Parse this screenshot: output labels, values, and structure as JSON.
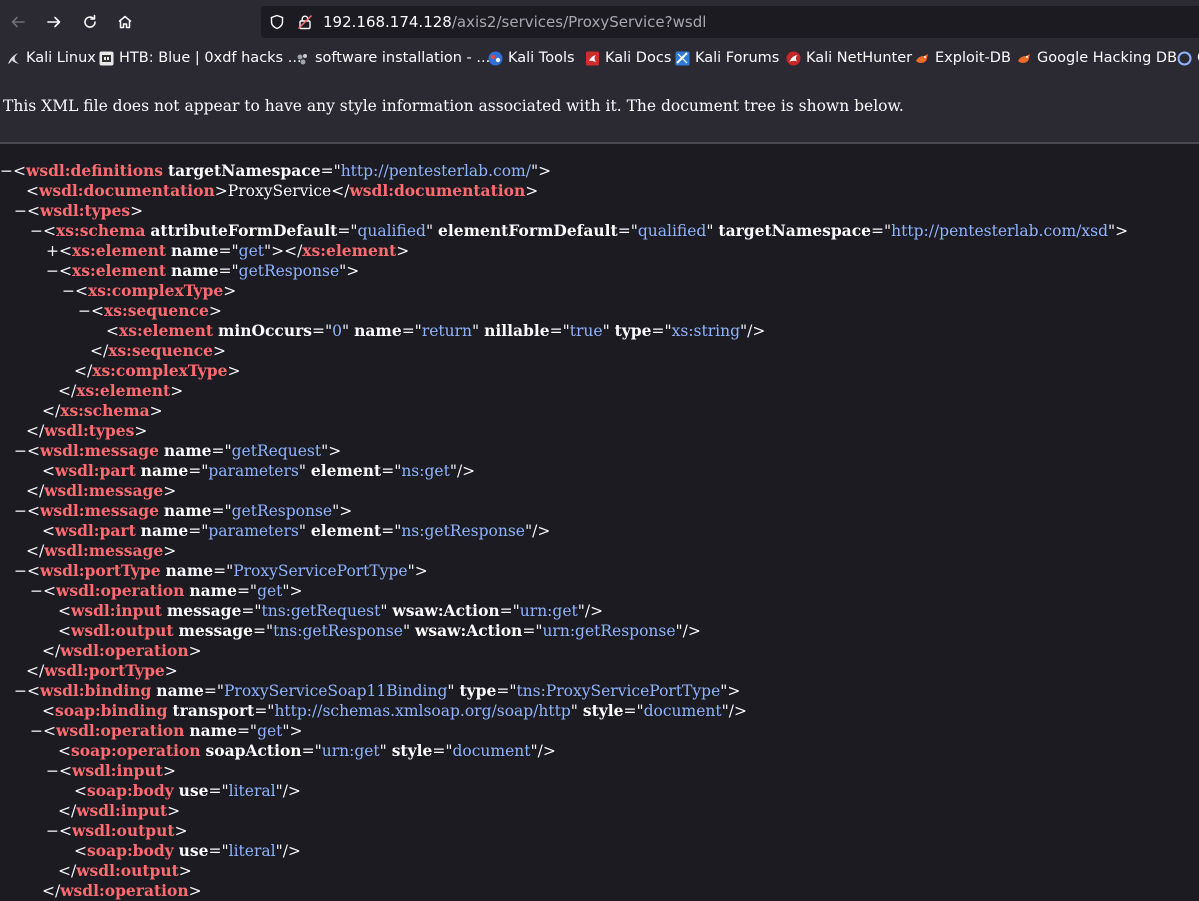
{
  "browser": {
    "url_host": "192.168.174.128",
    "url_path": "/axis2/services/ProxyService?wsdl"
  },
  "bookmarks": [
    {
      "label": "Kali Linux",
      "icon": "kali-dragon-icon"
    },
    {
      "label": "HTB: Blue | 0xdf hacks ...",
      "icon": "0xdf-icon"
    },
    {
      "label": "software installation - ...",
      "icon": "askubuntu-icon"
    },
    {
      "label": "Kali Tools",
      "icon": "kali-tools-icon"
    },
    {
      "label": "Kali Docs",
      "icon": "kali-docs-icon"
    },
    {
      "label": "Kali Forums",
      "icon": "kali-forums-icon"
    },
    {
      "label": "Kali NetHunter",
      "icon": "nethunter-icon"
    },
    {
      "label": "Exploit-DB",
      "icon": "exploit-db-icon"
    },
    {
      "label": "Google Hacking DB",
      "icon": "ghdb-icon"
    },
    {
      "label": "O",
      "icon": "offsec-icon"
    }
  ],
  "xml_info": "This XML file does not appear to have any style information associated with it. The document tree is shown below.",
  "colors": {
    "tag": "#ff6b70",
    "attr_value": "#8fb4ff",
    "page_bg": "#1c1b22",
    "chrome_bg": "#2b2a33"
  },
  "lines": [
    {
      "indent": 0,
      "toggle": "−",
      "seg": [
        [
          "p",
          "<"
        ],
        [
          "t",
          "wsdl:definitions"
        ],
        [
          "p",
          " "
        ],
        [
          "a",
          "targetNamespace"
        ],
        [
          "p",
          "=\""
        ],
        [
          "v",
          "http://pentesterlab.com/"
        ],
        [
          "p",
          "\">"
        ]
      ]
    },
    {
      "indent": 26,
      "toggle": "",
      "seg": [
        [
          "p",
          "<"
        ],
        [
          "t",
          "wsdl:documentation"
        ],
        [
          "p",
          ">"
        ],
        [
          "x",
          "ProxyService"
        ],
        [
          "p",
          "</"
        ],
        [
          "t",
          "wsdl:documentation"
        ],
        [
          "p",
          ">"
        ]
      ]
    },
    {
      "indent": 14,
      "toggle": "−",
      "seg": [
        [
          "p",
          "<"
        ],
        [
          "t",
          "wsdl:types"
        ],
        [
          "p",
          ">"
        ]
      ]
    },
    {
      "indent": 30,
      "toggle": "−",
      "seg": [
        [
          "p",
          "<"
        ],
        [
          "t",
          "xs:schema"
        ],
        [
          "p",
          " "
        ],
        [
          "a",
          "attributeFormDefault"
        ],
        [
          "p",
          "=\""
        ],
        [
          "v",
          "qualified"
        ],
        [
          "p",
          "\" "
        ],
        [
          "a",
          "elementFormDefault"
        ],
        [
          "p",
          "=\""
        ],
        [
          "v",
          "qualified"
        ],
        [
          "p",
          "\" "
        ],
        [
          "a",
          "targetNamespace"
        ],
        [
          "p",
          "=\""
        ],
        [
          "v",
          "http://pentesterlab.com/xsd"
        ],
        [
          "p",
          "\">"
        ]
      ]
    },
    {
      "indent": 46,
      "toggle": "+",
      "seg": [
        [
          "p",
          "<"
        ],
        [
          "t",
          "xs:element"
        ],
        [
          "p",
          " "
        ],
        [
          "a",
          "name"
        ],
        [
          "p",
          "=\""
        ],
        [
          "v",
          "get"
        ],
        [
          "p",
          "\"></"
        ],
        [
          "t",
          "xs:element"
        ],
        [
          "p",
          ">"
        ]
      ]
    },
    {
      "indent": 46,
      "toggle": "−",
      "seg": [
        [
          "p",
          "<"
        ],
        [
          "t",
          "xs:element"
        ],
        [
          "p",
          " "
        ],
        [
          "a",
          "name"
        ],
        [
          "p",
          "=\""
        ],
        [
          "v",
          "getResponse"
        ],
        [
          "p",
          "\">"
        ]
      ]
    },
    {
      "indent": 62,
      "toggle": "−",
      "seg": [
        [
          "p",
          "<"
        ],
        [
          "t",
          "xs:complexType"
        ],
        [
          "p",
          ">"
        ]
      ]
    },
    {
      "indent": 78,
      "toggle": "−",
      "seg": [
        [
          "p",
          "<"
        ],
        [
          "t",
          "xs:sequence"
        ],
        [
          "p",
          ">"
        ]
      ]
    },
    {
      "indent": 106,
      "toggle": "",
      "seg": [
        [
          "p",
          "<"
        ],
        [
          "t",
          "xs:element"
        ],
        [
          "p",
          " "
        ],
        [
          "a",
          "minOccurs"
        ],
        [
          "p",
          "=\""
        ],
        [
          "v",
          "0"
        ],
        [
          "p",
          "\" "
        ],
        [
          "a",
          "name"
        ],
        [
          "p",
          "=\""
        ],
        [
          "v",
          "return"
        ],
        [
          "p",
          "\" "
        ],
        [
          "a",
          "nillable"
        ],
        [
          "p",
          "=\""
        ],
        [
          "v",
          "true"
        ],
        [
          "p",
          "\" "
        ],
        [
          "a",
          "type"
        ],
        [
          "p",
          "=\""
        ],
        [
          "v",
          "xs:string"
        ],
        [
          "p",
          "\"/>"
        ]
      ]
    },
    {
      "indent": 90,
      "toggle": "",
      "seg": [
        [
          "p",
          "</"
        ],
        [
          "t",
          "xs:sequence"
        ],
        [
          "p",
          ">"
        ]
      ]
    },
    {
      "indent": 74,
      "toggle": "",
      "seg": [
        [
          "p",
          "</"
        ],
        [
          "t",
          "xs:complexType"
        ],
        [
          "p",
          ">"
        ]
      ]
    },
    {
      "indent": 58,
      "toggle": "",
      "seg": [
        [
          "p",
          "</"
        ],
        [
          "t",
          "xs:element"
        ],
        [
          "p",
          ">"
        ]
      ]
    },
    {
      "indent": 42,
      "toggle": "",
      "seg": [
        [
          "p",
          "</"
        ],
        [
          "t",
          "xs:schema"
        ],
        [
          "p",
          ">"
        ]
      ]
    },
    {
      "indent": 26,
      "toggle": "",
      "seg": [
        [
          "p",
          "</"
        ],
        [
          "t",
          "wsdl:types"
        ],
        [
          "p",
          ">"
        ]
      ]
    },
    {
      "indent": 14,
      "toggle": "−",
      "seg": [
        [
          "p",
          "<"
        ],
        [
          "t",
          "wsdl:message"
        ],
        [
          "p",
          " "
        ],
        [
          "a",
          "name"
        ],
        [
          "p",
          "=\""
        ],
        [
          "v",
          "getRequest"
        ],
        [
          "p",
          "\">"
        ]
      ]
    },
    {
      "indent": 42,
      "toggle": "",
      "seg": [
        [
          "p",
          "<"
        ],
        [
          "t",
          "wsdl:part"
        ],
        [
          "p",
          " "
        ],
        [
          "a",
          "name"
        ],
        [
          "p",
          "=\""
        ],
        [
          "v",
          "parameters"
        ],
        [
          "p",
          "\" "
        ],
        [
          "a",
          "element"
        ],
        [
          "p",
          "=\""
        ],
        [
          "v",
          "ns:get"
        ],
        [
          "p",
          "\"/>"
        ]
      ]
    },
    {
      "indent": 26,
      "toggle": "",
      "seg": [
        [
          "p",
          "</"
        ],
        [
          "t",
          "wsdl:message"
        ],
        [
          "p",
          ">"
        ]
      ]
    },
    {
      "indent": 14,
      "toggle": "−",
      "seg": [
        [
          "p",
          "<"
        ],
        [
          "t",
          "wsdl:message"
        ],
        [
          "p",
          " "
        ],
        [
          "a",
          "name"
        ],
        [
          "p",
          "=\""
        ],
        [
          "v",
          "getResponse"
        ],
        [
          "p",
          "\">"
        ]
      ]
    },
    {
      "indent": 42,
      "toggle": "",
      "seg": [
        [
          "p",
          "<"
        ],
        [
          "t",
          "wsdl:part"
        ],
        [
          "p",
          " "
        ],
        [
          "a",
          "name"
        ],
        [
          "p",
          "=\""
        ],
        [
          "v",
          "parameters"
        ],
        [
          "p",
          "\" "
        ],
        [
          "a",
          "element"
        ],
        [
          "p",
          "=\""
        ],
        [
          "v",
          "ns:getResponse"
        ],
        [
          "p",
          "\"/>"
        ]
      ]
    },
    {
      "indent": 26,
      "toggle": "",
      "seg": [
        [
          "p",
          "</"
        ],
        [
          "t",
          "wsdl:message"
        ],
        [
          "p",
          ">"
        ]
      ]
    },
    {
      "indent": 14,
      "toggle": "−",
      "seg": [
        [
          "p",
          "<"
        ],
        [
          "t",
          "wsdl:portType"
        ],
        [
          "p",
          " "
        ],
        [
          "a",
          "name"
        ],
        [
          "p",
          "=\""
        ],
        [
          "v",
          "ProxyServicePortType"
        ],
        [
          "p",
          "\">"
        ]
      ]
    },
    {
      "indent": 30,
      "toggle": "−",
      "seg": [
        [
          "p",
          "<"
        ],
        [
          "t",
          "wsdl:operation"
        ],
        [
          "p",
          " "
        ],
        [
          "a",
          "name"
        ],
        [
          "p",
          "=\""
        ],
        [
          "v",
          "get"
        ],
        [
          "p",
          "\">"
        ]
      ]
    },
    {
      "indent": 58,
      "toggle": "",
      "seg": [
        [
          "p",
          "<"
        ],
        [
          "t",
          "wsdl:input"
        ],
        [
          "p",
          " "
        ],
        [
          "a",
          "message"
        ],
        [
          "p",
          "=\""
        ],
        [
          "v",
          "tns:getRequest"
        ],
        [
          "p",
          "\" "
        ],
        [
          "a",
          "wsaw:Action"
        ],
        [
          "p",
          "=\""
        ],
        [
          "v",
          "urn:get"
        ],
        [
          "p",
          "\"/>"
        ]
      ]
    },
    {
      "indent": 58,
      "toggle": "",
      "seg": [
        [
          "p",
          "<"
        ],
        [
          "t",
          "wsdl:output"
        ],
        [
          "p",
          " "
        ],
        [
          "a",
          "message"
        ],
        [
          "p",
          "=\""
        ],
        [
          "v",
          "tns:getResponse"
        ],
        [
          "p",
          "\" "
        ],
        [
          "a",
          "wsaw:Action"
        ],
        [
          "p",
          "=\""
        ],
        [
          "v",
          "urn:getResponse"
        ],
        [
          "p",
          "\"/>"
        ]
      ]
    },
    {
      "indent": 42,
      "toggle": "",
      "seg": [
        [
          "p",
          "</"
        ],
        [
          "t",
          "wsdl:operation"
        ],
        [
          "p",
          ">"
        ]
      ]
    },
    {
      "indent": 26,
      "toggle": "",
      "seg": [
        [
          "p",
          "</"
        ],
        [
          "t",
          "wsdl:portType"
        ],
        [
          "p",
          ">"
        ]
      ]
    },
    {
      "indent": 14,
      "toggle": "−",
      "seg": [
        [
          "p",
          "<"
        ],
        [
          "t",
          "wsdl:binding"
        ],
        [
          "p",
          " "
        ],
        [
          "a",
          "name"
        ],
        [
          "p",
          "=\""
        ],
        [
          "v",
          "ProxyServiceSoap11Binding"
        ],
        [
          "p",
          "\" "
        ],
        [
          "a",
          "type"
        ],
        [
          "p",
          "=\""
        ],
        [
          "v",
          "tns:ProxyServicePortType"
        ],
        [
          "p",
          "\">"
        ]
      ]
    },
    {
      "indent": 42,
      "toggle": "",
      "seg": [
        [
          "p",
          "<"
        ],
        [
          "t",
          "soap:binding"
        ],
        [
          "p",
          " "
        ],
        [
          "a",
          "transport"
        ],
        [
          "p",
          "=\""
        ],
        [
          "v",
          "http://schemas.xmlsoap.org/soap/http"
        ],
        [
          "p",
          "\" "
        ],
        [
          "a",
          "style"
        ],
        [
          "p",
          "=\""
        ],
        [
          "v",
          "document"
        ],
        [
          "p",
          "\"/>"
        ]
      ]
    },
    {
      "indent": 30,
      "toggle": "−",
      "seg": [
        [
          "p",
          "<"
        ],
        [
          "t",
          "wsdl:operation"
        ],
        [
          "p",
          " "
        ],
        [
          "a",
          "name"
        ],
        [
          "p",
          "=\""
        ],
        [
          "v",
          "get"
        ],
        [
          "p",
          "\">"
        ]
      ]
    },
    {
      "indent": 58,
      "toggle": "",
      "seg": [
        [
          "p",
          "<"
        ],
        [
          "t",
          "soap:operation"
        ],
        [
          "p",
          " "
        ],
        [
          "a",
          "soapAction"
        ],
        [
          "p",
          "=\""
        ],
        [
          "v",
          "urn:get"
        ],
        [
          "p",
          "\" "
        ],
        [
          "a",
          "style"
        ],
        [
          "p",
          "=\""
        ],
        [
          "v",
          "document"
        ],
        [
          "p",
          "\"/>"
        ]
      ]
    },
    {
      "indent": 46,
      "toggle": "−",
      "seg": [
        [
          "p",
          "<"
        ],
        [
          "t",
          "wsdl:input"
        ],
        [
          "p",
          ">"
        ]
      ]
    },
    {
      "indent": 74,
      "toggle": "",
      "seg": [
        [
          "p",
          "<"
        ],
        [
          "t",
          "soap:body"
        ],
        [
          "p",
          " "
        ],
        [
          "a",
          "use"
        ],
        [
          "p",
          "=\""
        ],
        [
          "v",
          "literal"
        ],
        [
          "p",
          "\"/>"
        ]
      ]
    },
    {
      "indent": 58,
      "toggle": "",
      "seg": [
        [
          "p",
          "</"
        ],
        [
          "t",
          "wsdl:input"
        ],
        [
          "p",
          ">"
        ]
      ]
    },
    {
      "indent": 46,
      "toggle": "−",
      "seg": [
        [
          "p",
          "<"
        ],
        [
          "t",
          "wsdl:output"
        ],
        [
          "p",
          ">"
        ]
      ]
    },
    {
      "indent": 74,
      "toggle": "",
      "seg": [
        [
          "p",
          "<"
        ],
        [
          "t",
          "soap:body"
        ],
        [
          "p",
          " "
        ],
        [
          "a",
          "use"
        ],
        [
          "p",
          "=\""
        ],
        [
          "v",
          "literal"
        ],
        [
          "p",
          "\"/>"
        ]
      ]
    },
    {
      "indent": 58,
      "toggle": "",
      "seg": [
        [
          "p",
          "</"
        ],
        [
          "t",
          "wsdl:output"
        ],
        [
          "p",
          ">"
        ]
      ]
    },
    {
      "indent": 42,
      "toggle": "",
      "seg": [
        [
          "p",
          "</"
        ],
        [
          "t",
          "wsdl:operation"
        ],
        [
          "p",
          ">"
        ]
      ]
    }
  ]
}
